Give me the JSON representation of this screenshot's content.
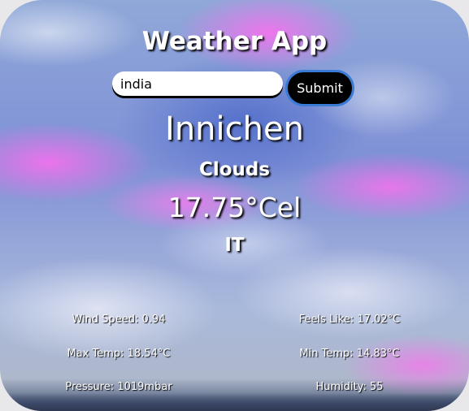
{
  "app": {
    "title": "Weather App"
  },
  "search": {
    "value": "india",
    "submit_label": "Submit"
  },
  "weather": {
    "city": "Innichen",
    "condition": "Clouds",
    "temperature": "17.75°Cel",
    "country": "IT"
  },
  "details": {
    "wind_speed": "Wind Speed: 0.94",
    "feels_like": "Feels Like: 17.02°C",
    "max_temp": "Max Temp: 18.54°C",
    "min_temp": "Min Temp: 14.83°C",
    "pressure": "Pressure: 1019mbar",
    "humidity": "Humidity: 55"
  },
  "colors": {
    "text": "#ffffff",
    "button_bg": "#000000",
    "button_border": "#3a7bd5",
    "accent_pink": "#ff6ef0"
  }
}
